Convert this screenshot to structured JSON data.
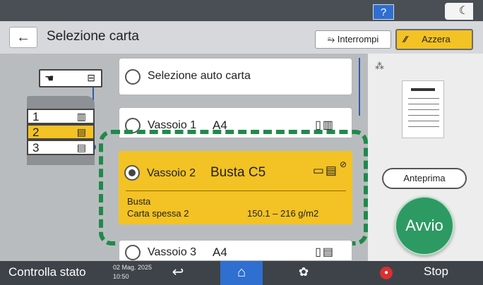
{
  "topbar": {
    "help_label": "?",
    "energy_icon": "crescent-moon-icon"
  },
  "header": {
    "back_icon": "←",
    "title": "Selezione carta",
    "interrupt_label": "Interrompi",
    "interrupt_icon": "interrupt-icon",
    "reset_label": "Azzera",
    "reset_icon": "reset-icon"
  },
  "diagram": {
    "trays": [
      {
        "number": "1",
        "icon": "paper-stack-icon"
      },
      {
        "number": "2",
        "icon": "paper-stack-icon",
        "active": true
      },
      {
        "number": "3",
        "icon": "paper-stack-icon"
      }
    ],
    "colors": {
      "active": "#f3c224",
      "connector": "#2e5ca8"
    }
  },
  "options": {
    "auto": {
      "label": "Selezione auto carta"
    },
    "tray1": {
      "label": "Vassoio 1",
      "size": "A4"
    },
    "tray2": {
      "label": "Vassoio 2",
      "size": "Busta C5",
      "type": "Busta",
      "weight_name": "Carta spessa 2",
      "weight_value": "150.1 – 216 g/m2",
      "selected": true
    },
    "tray3": {
      "label": "Vassoio 3",
      "size": "A4"
    }
  },
  "right_panel": {
    "preview_label": "Anteprima",
    "start_label": "Avvio"
  },
  "bottombar": {
    "status_label": "Controlla stato",
    "date": "02 Mag. 2025",
    "time": "10:50",
    "stop_label": "Stop"
  },
  "accent_colors": {
    "selected": "#f3c224",
    "highlight_frame": "#1f8a4a",
    "start": "#2e9a63",
    "home": "#2f6fd0"
  }
}
